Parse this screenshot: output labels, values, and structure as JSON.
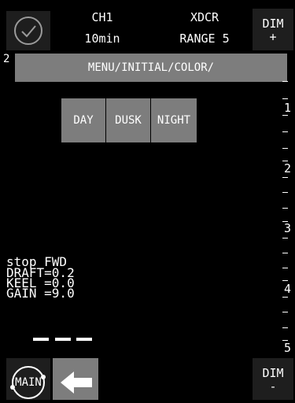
{
  "header": {
    "channel": "CH1",
    "range_time": "10min",
    "transducer": "XDCR",
    "range": "RANGE 5",
    "dim_up_label": "DIM",
    "dim_up_sign": "+"
  },
  "overlay": {
    "left_digit": "2"
  },
  "menu": {
    "breadcrumb": "MENU/INITIAL/COLOR/",
    "options": [
      "DAY",
      "DUSK",
      "NIGHT"
    ]
  },
  "status": {
    "line1": "stop FWD",
    "line2": "DRAFT=0.2",
    "line3": "KEEL =0.0",
    "line4": "GAIN =9.0"
  },
  "depth_scale": {
    "labels": [
      "1",
      "2",
      "3",
      "4",
      "5"
    ]
  },
  "footer": {
    "main_label": "MAIN",
    "dim_down_label": "DIM",
    "dim_down_sign": "-"
  },
  "colors": {
    "background": "#000000",
    "menu_gray": "#7d7d7d",
    "button_dark": "#1e1e1e"
  },
  "icons": {
    "status_circle": "check-circle-icon",
    "back": "back-arrow-icon"
  }
}
